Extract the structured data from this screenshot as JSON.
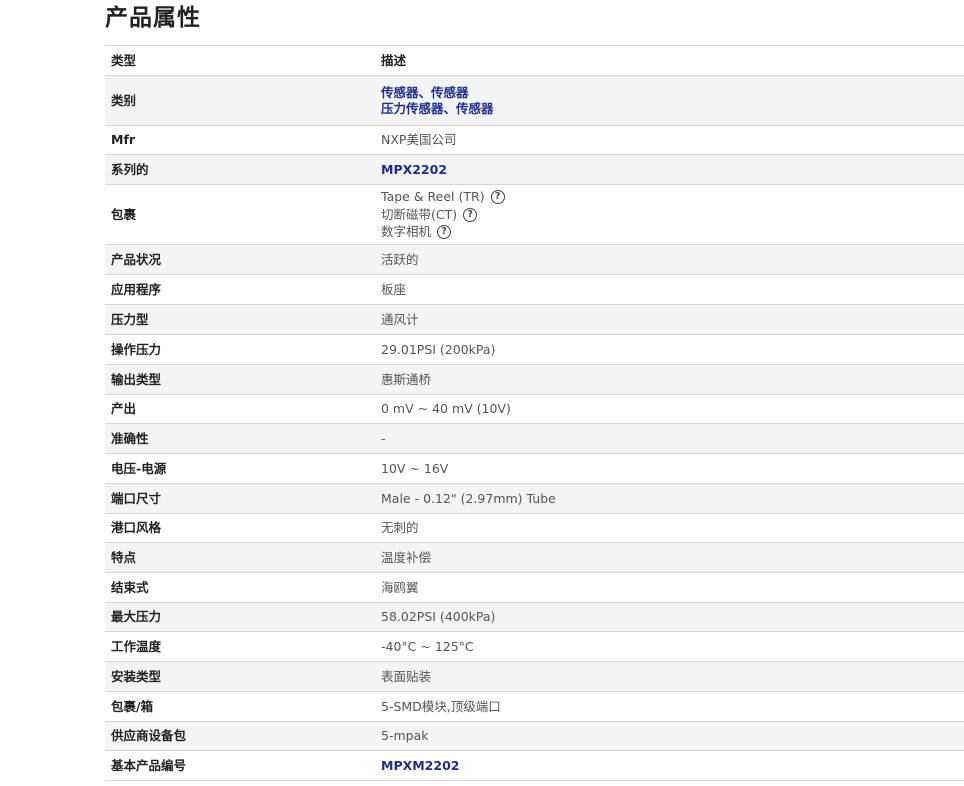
{
  "section_title": "产品属性",
  "header": {
    "type_label": "类型",
    "desc_label": "描述"
  },
  "rows": [
    {
      "label": "类别",
      "values": [
        "传感器、传感器",
        "压力传感器、传感器"
      ],
      "link": true
    },
    {
      "label": "Mfr",
      "value": "NXP美国公司"
    },
    {
      "label": "系列的",
      "value": "MPX2202",
      "link": true
    },
    {
      "label": "包裹",
      "packaging": [
        "Tape & Reel (TR)",
        "切断磁带(CT)",
        "数字相机"
      ]
    },
    {
      "label": "产品状况",
      "value": "活跃的"
    },
    {
      "label": "应用程序",
      "value": "板座"
    },
    {
      "label": "压力型",
      "value": "通风计"
    },
    {
      "label": "操作压力",
      "value": "29.01PSI (200kPa)"
    },
    {
      "label": "输出类型",
      "value": "惠斯通桥"
    },
    {
      "label": "产出",
      "value": "0 mV ~ 40 mV (10V)"
    },
    {
      "label": "准确性",
      "value": "-"
    },
    {
      "label": "电压-电源",
      "value": "10V ~ 16V"
    },
    {
      "label": "端口尺寸",
      "value": "Male - 0.12\" (2.97mm) Tube"
    },
    {
      "label": "港口风格",
      "value": "无刺的"
    },
    {
      "label": "特点",
      "value": "温度补偿"
    },
    {
      "label": "结束式",
      "value": "海鸥翼"
    },
    {
      "label": "最大压力",
      "value": "58.02PSI (400kPa)"
    },
    {
      "label": "工作温度",
      "value": "-40°C ~ 125°C"
    },
    {
      "label": "安装类型",
      "value": "表面贴装"
    },
    {
      "label": "包裹/箱",
      "value": "5-SMD模块,顶级端口"
    },
    {
      "label": "供应商设备包",
      "value": "5-mpak"
    },
    {
      "label": "基本产品编号",
      "value": "MPXM2202",
      "link": true
    }
  ],
  "help_icon": "question-circle-icon",
  "colors": {
    "link": "#1f2e8e",
    "row_alt": "#f4f4f4",
    "border": "#d4d4d4"
  }
}
